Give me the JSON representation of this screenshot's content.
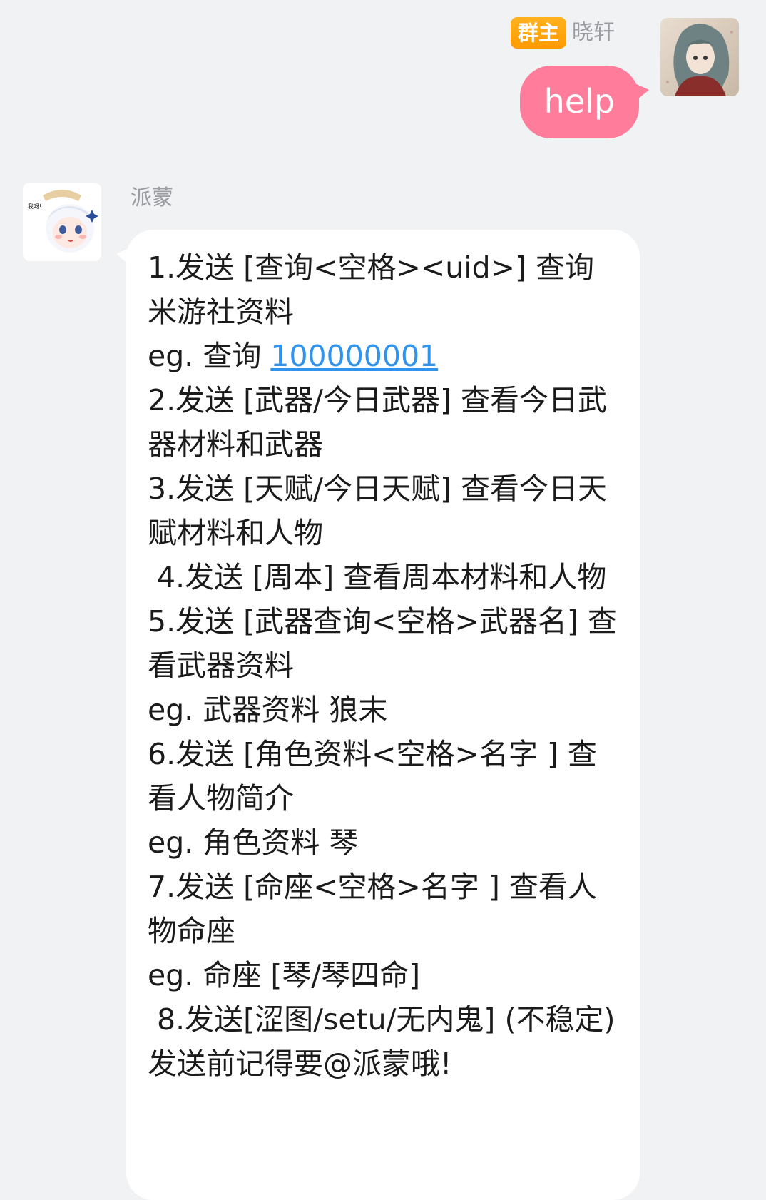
{
  "outgoing": {
    "badge": "群主",
    "sender": "晓轩",
    "text": "help"
  },
  "incoming": {
    "sender": "派蒙",
    "avatar_caption": "我呀!",
    "lines": [
      {
        "text": "1.发送 [查询<空格><uid>] 查询米游社资料"
      },
      {
        "text": "eg. 查询 ",
        "link": "100000001"
      },
      {
        "text": "2.发送 [武器/今日武器] 查看今日武器材料和武器"
      },
      {
        "text": "3.发送 [天赋/今日天赋] 查看今日天赋材料和人物"
      },
      {
        "text": " 4.发送 [周本] 查看周本材料和人物"
      },
      {
        "text": "5.发送 [武器查询<空格>武器名] 查看武器资料"
      },
      {
        "text": "eg. 武器资料 狼末"
      },
      {
        "text": "6.发送 [角色资料<空格>名字 ] 查看人物简介"
      },
      {
        "text": "eg. 角色资料 琴"
      },
      {
        "text": "7.发送 [命座<空格>名字 ] 查看人物命座"
      },
      {
        "text": "eg. 命座 [琴/琴四命]"
      },
      {
        "text": " 8.发送[涩图/setu/无内鬼] (不稳定)"
      },
      {
        "text": "发送前记得要@派蒙哦!"
      }
    ]
  },
  "colors": {
    "background": "#f1f2f4",
    "outgoing_bubble": "#ff7c9b",
    "incoming_bubble": "#ffffff",
    "owner_badge": "#ff9a00",
    "link": "#2f93f0",
    "name_text": "#9a9ca1"
  }
}
